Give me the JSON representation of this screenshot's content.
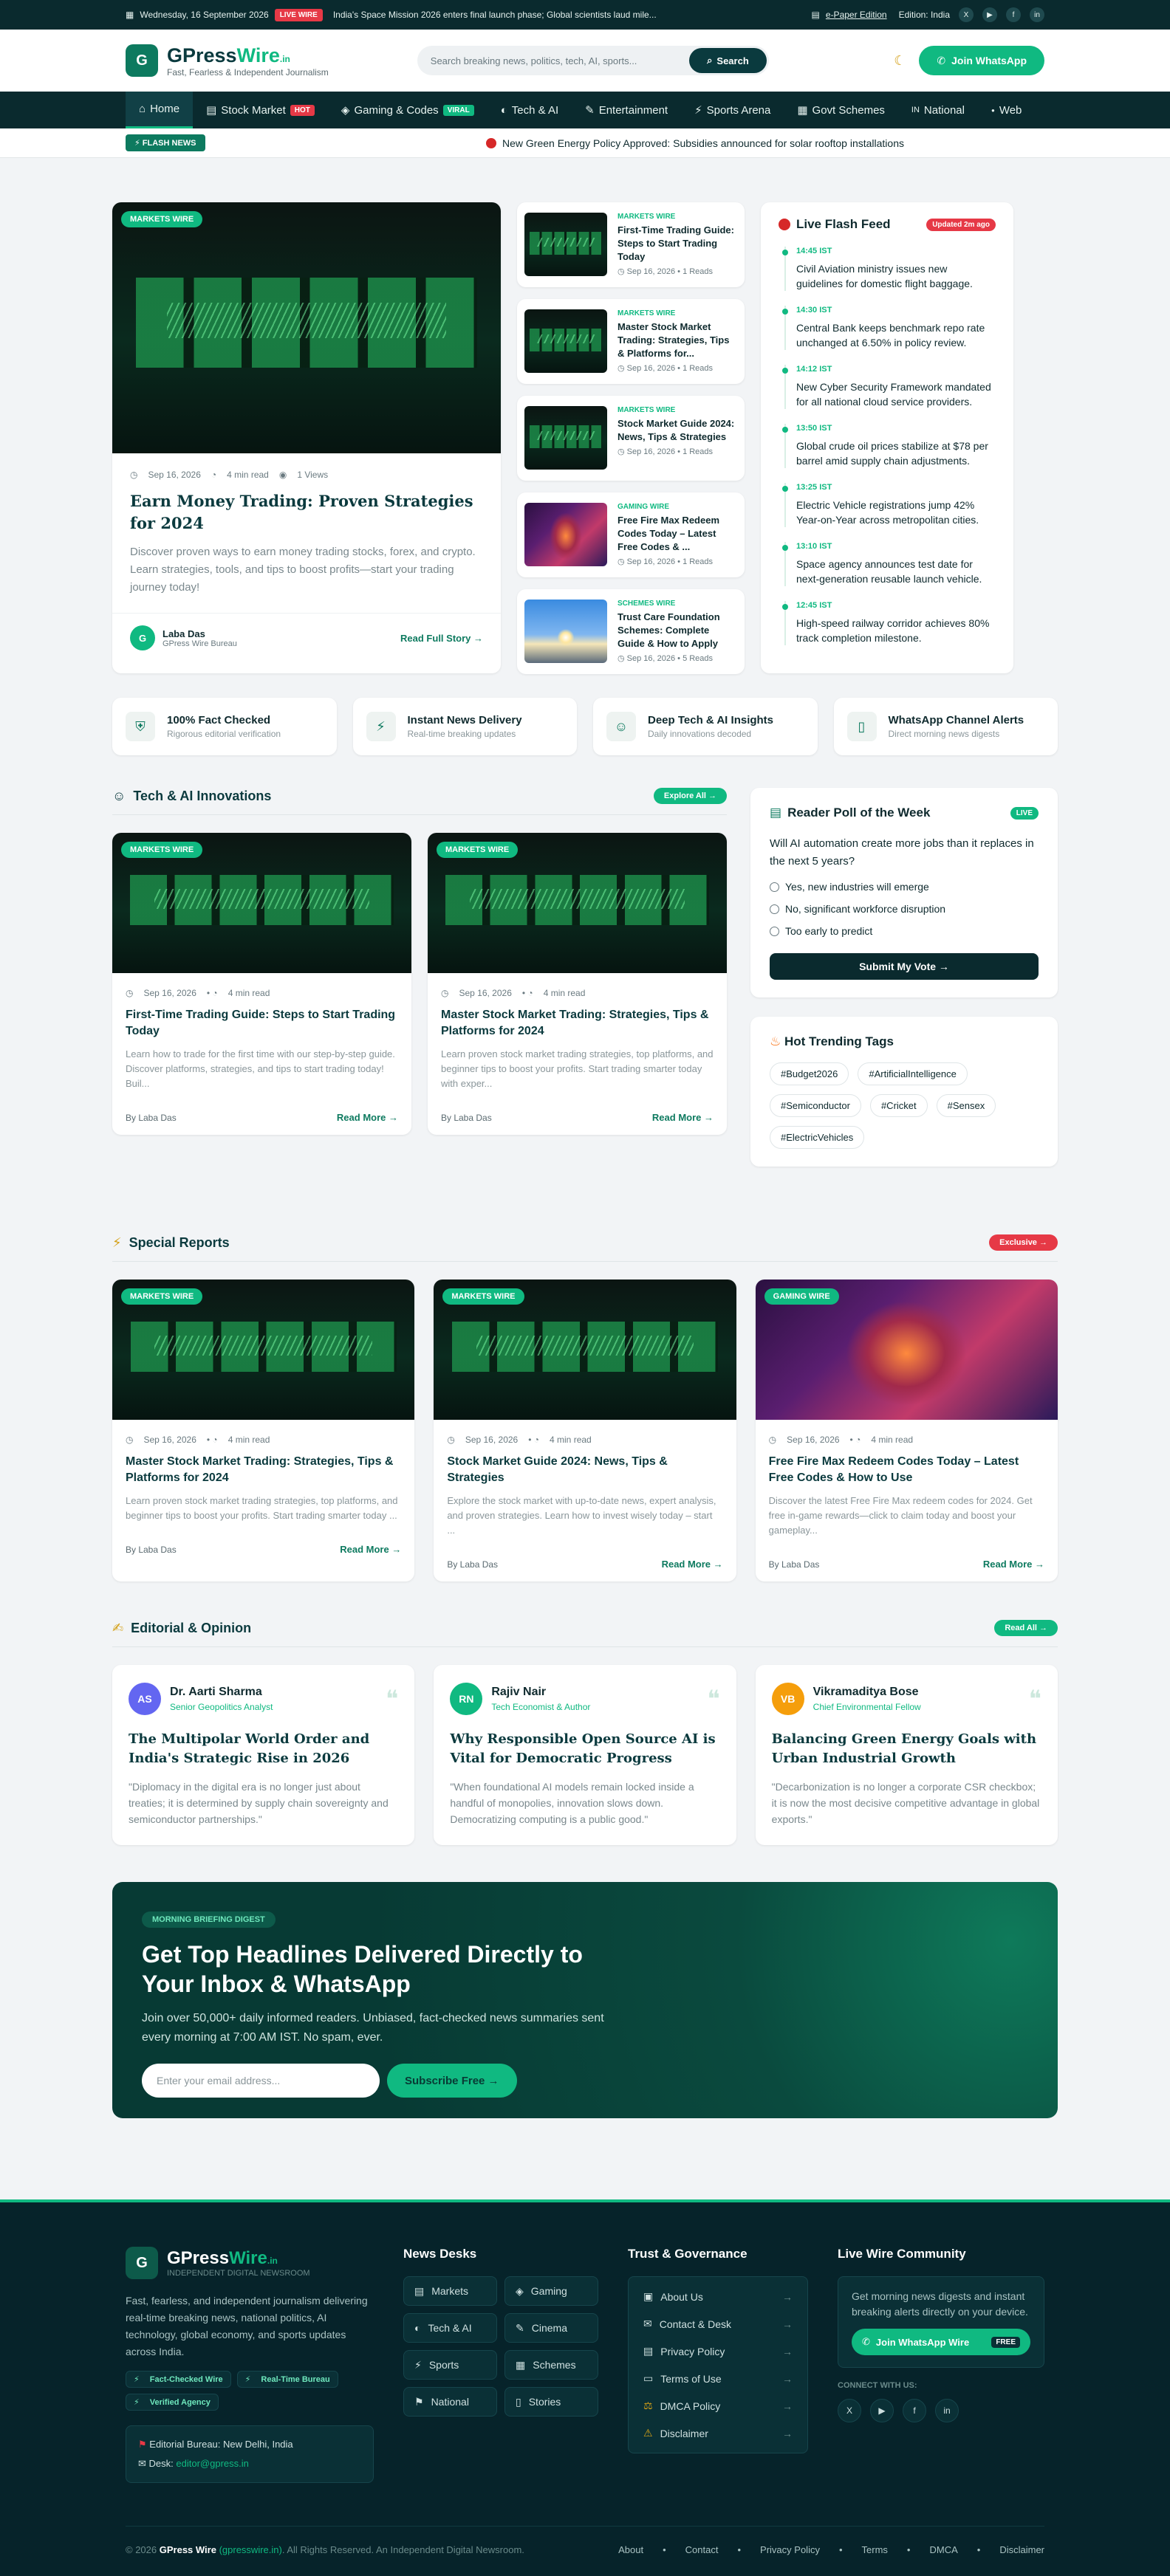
{
  "topbar": {
    "date": "Wednesday, 16 September 2026",
    "live": "LIVE WIRE",
    "ticker": "India's Space Mission 2026 enters final launch phase; Global scientists laud mile...",
    "epaper": "e-Paper Edition",
    "edition": "Edition: India",
    "social": [
      "X",
      "▶",
      "f",
      "in"
    ]
  },
  "header": {
    "logo_letter": "G",
    "name_a": "GPress",
    "name_b": "Wire",
    "tld": ".in",
    "tagline": "Fast, Fearless & Independent Journalism",
    "search_placeholder": "Search breaking news, politics, tech, AI, sports...",
    "search_btn": "Search",
    "wa_btn": "Join WhatsApp"
  },
  "nav": [
    {
      "label": "Home",
      "icon": "⌂"
    },
    {
      "label": "Stock Market",
      "icon": "▤",
      "badge": "HOT",
      "badge_color": "#e63946"
    },
    {
      "label": "Gaming & Codes",
      "icon": "◈",
      "badge": "VIRAL",
      "badge_color": "#10b981"
    },
    {
      "label": "Tech & AI",
      "icon": "◐"
    },
    {
      "label": "Entertainment",
      "icon": "✎"
    },
    {
      "label": "Sports Arena",
      "icon": "⚡"
    },
    {
      "label": "Govt Schemes",
      "icon": "▦"
    },
    {
      "label": "National",
      "icon": "IN"
    },
    {
      "label": "Web",
      "icon": "●"
    }
  ],
  "flash": {
    "label": "⚡ FLASH NEWS",
    "text": "New Green Energy Policy Approved: Subsidies announced for solar rooftop installations"
  },
  "hero": {
    "cat": "MARKETS WIRE",
    "date": "Sep 16, 2026",
    "read": "4 min read",
    "views": "1 Views",
    "title": "Earn Money Trading: Proven Strategies for 2024",
    "desc": "Discover proven ways to earn money trading stocks, forex, and crypto. Learn strategies, tools, and tips to boost profits—start your trading journey today!",
    "author": "Laba Das",
    "bureau": "GPress Wire Bureau",
    "read_full": "Read Full Story →",
    "avatar": "G"
  },
  "side": [
    {
      "cat": "MARKETS WIRE",
      "title": "First-Time Trading Guide: Steps to Start Trading Today",
      "meta": "Sep 16, 2026 • 1 Reads",
      "img": "trade"
    },
    {
      "cat": "MARKETS WIRE",
      "title": "Master Stock Market Trading: Strategies, Tips & Platforms for...",
      "meta": "Sep 16, 2026 • 1 Reads",
      "img": "trade"
    },
    {
      "cat": "MARKETS WIRE",
      "title": "Stock Market Guide 2024: News, Tips & Strategies",
      "meta": "Sep 16, 2026 • 1 Reads",
      "img": "trade"
    },
    {
      "cat": "GAMING WIRE",
      "title": "Free Fire Max Redeem Codes Today – Latest Free Codes & ...",
      "meta": "Sep 16, 2026 • 1 Reads",
      "img": "game"
    },
    {
      "cat": "SCHEMES WIRE",
      "title": "Trust Care Foundation Schemes: Complete Guide & How to Apply",
      "meta": "Sep 16, 2026 • 5 Reads",
      "img": "sky"
    }
  ],
  "feed": {
    "title": "Live Flash Feed",
    "updated": "Updated 2m ago",
    "items": [
      {
        "time": "14:45 IST",
        "text": "Civil Aviation ministry issues new guidelines for domestic flight baggage."
      },
      {
        "time": "14:30 IST",
        "text": "Central Bank keeps benchmark repo rate unchanged at 6.50% in policy review."
      },
      {
        "time": "14:12 IST",
        "text": "New Cyber Security Framework mandated for all national cloud service providers."
      },
      {
        "time": "13:50 IST",
        "text": "Global crude oil prices stabilize at $78 per barrel amid supply chain adjustments."
      },
      {
        "time": "13:25 IST",
        "text": "Electric Vehicle registrations jump 42% Year-on-Year across metropolitan cities."
      },
      {
        "time": "13:10 IST",
        "text": "Space agency announces test date for next-generation reusable launch vehicle."
      },
      {
        "time": "12:45 IST",
        "text": "High-speed railway corridor achieves 80% track completion milestone."
      }
    ]
  },
  "trust": [
    {
      "icon": "⛨",
      "title": "100% Fact Checked",
      "sub": "Rigorous editorial verification"
    },
    {
      "icon": "⚡",
      "title": "Instant News Delivery",
      "sub": "Real-time breaking updates"
    },
    {
      "icon": "☺",
      "title": "Deep Tech & AI Insights",
      "sub": "Daily innovations decoded"
    },
    {
      "icon": "▯",
      "title": "WhatsApp Channel Alerts",
      "sub": "Direct morning news digests"
    }
  ],
  "tech": {
    "title": "Tech & AI Innovations",
    "btn": "Explore All →",
    "articles": [
      {
        "cat": "MARKETS WIRE",
        "date": "Sep 16, 2026",
        "read": "4 min read",
        "title": "First-Time Trading Guide: Steps to Start Trading Today",
        "desc": "Learn how to trade for the first time with our step-by-step guide. Discover platforms, strategies, and tips to start trading today! Buil...",
        "by": "By Laba Das",
        "rm": "Read More →"
      },
      {
        "cat": "MARKETS WIRE",
        "date": "Sep 16, 2026",
        "read": "4 min read",
        "title": "Master Stock Market Trading: Strategies, Tips & Platforms for 2024",
        "desc": "Learn proven stock market trading strategies, top platforms, and beginner tips to boost your profits. Start trading smarter today with exper...",
        "by": "By Laba Das",
        "rm": "Read More →"
      }
    ]
  },
  "poll": {
    "title": "Reader Poll of the Week",
    "live": "LIVE",
    "question": "Will AI automation create more jobs than it replaces in the next 5 years?",
    "options": [
      "Yes, new industries will emerge",
      "No, significant workforce disruption",
      "Too early to predict"
    ],
    "submit": "Submit My Vote →"
  },
  "tags": {
    "title": "Hot Trending Tags",
    "items": [
      "#Budget2026",
      "#ArtificialIntelligence",
      "#Semiconductor",
      "#Cricket",
      "#Sensex",
      "#ElectricVehicles"
    ]
  },
  "special": {
    "title": "Special Reports",
    "btn": "Exclusive →",
    "articles": [
      {
        "cat": "MARKETS WIRE",
        "img": "trade",
        "date": "Sep 16, 2026",
        "read": "4 min read",
        "title": "Master Stock Market Trading: Strategies, Tips & Platforms for 2024",
        "desc": "Learn proven stock market trading strategies, top platforms, and beginner tips to boost your profits. Start trading smarter today ...",
        "by": "By Laba Das",
        "rm": "Read More →"
      },
      {
        "cat": "MARKETS WIRE",
        "img": "trade",
        "date": "Sep 16, 2026",
        "read": "4 min read",
        "title": "Stock Market Guide 2024: News, Tips & Strategies",
        "desc": "Explore the stock market with up-to-date news, expert analysis, and proven strategies. Learn how to invest wisely today – start ...",
        "by": "By Laba Das",
        "rm": "Read More →"
      },
      {
        "cat": "GAMING WIRE",
        "img": "game",
        "date": "Sep 16, 2026",
        "read": "4 min read",
        "title": "Free Fire Max Redeem Codes Today – Latest Free Codes & How to Use",
        "desc": "Discover the latest Free Fire Max redeem codes for 2024. Get free in-game rewards—click to claim today and boost your gameplay...",
        "by": "By Laba Das",
        "rm": "Read More →"
      }
    ]
  },
  "editorial": {
    "title": "Editorial & Opinion",
    "btn": "Read All →",
    "items": [
      {
        "initials": "AS",
        "color": "#6366f1",
        "name": "Dr. Aarti Sharma",
        "role": "Senior Geopolitics Analyst",
        "title": "The Multipolar World Order and India's Strategic Rise in 2026",
        "quote": "\"Diplomacy in the digital era is no longer just about treaties; it is determined by supply chain sovereignty and semiconductor partnerships.\""
      },
      {
        "initials": "RN",
        "color": "#10b981",
        "name": "Rajiv Nair",
        "role": "Tech Economist & Author",
        "title": "Why Responsible Open Source AI is Vital for Democratic Progress",
        "quote": "\"When foundational AI models remain locked inside a handful of monopolies, innovation slows down. Democratizing computing is a public good.\""
      },
      {
        "initials": "VB",
        "color": "#f59e0b",
        "name": "Vikramaditya Bose",
        "role": "Chief Environmental Fellow",
        "title": "Balancing Green Energy Goals with Urban Industrial Growth",
        "quote": "\"Decarbonization is no longer a corporate CSR checkbox; it is now the most decisive competitive advantage in global exports.\""
      }
    ]
  },
  "newsletter": {
    "kicker": "MORNING BRIEFING DIGEST",
    "title": "Get Top Headlines Delivered Directly to Your Inbox & WhatsApp",
    "desc": "Join over 50,000+ daily informed readers. Unbiased, fact-checked news summaries sent every morning at 7:00 AM IST. No spam, ever.",
    "placeholder": "Enter your email address...",
    "btn": "Subscribe Free →"
  },
  "footer": {
    "sub": "INDEPENDENT DIGITAL NEWSROOM",
    "about": "Fast, fearless, and independent journalism delivering real-time breaking news, national politics, AI technology, global economy, and sports updates across India.",
    "badges": [
      "Fact-Checked Wire",
      "Real-Time Bureau",
      "Verified Agency"
    ],
    "bureau": "Editorial Bureau: New Delhi, India",
    "desk_label": "Desk:",
    "desk": "editor@gpress.in",
    "desks_title": "News Desks",
    "desks": [
      "Markets",
      "Gaming",
      "Tech & AI",
      "Cinema",
      "Sports",
      "Schemes",
      "National",
      "Stories"
    ],
    "trust_title": "Trust & Governance",
    "trust": [
      "About Us",
      "Contact & Desk",
      "Privacy Policy",
      "Terms of Use",
      "DMCA Policy",
      "Disclaimer"
    ],
    "comm_title": "Live Wire Community",
    "comm_text": "Get morning news digests and instant breaking alerts directly on your device.",
    "comm_btn": "Join WhatsApp Wire",
    "comm_free": "FREE",
    "connect": "CONNECT WITH US:",
    "copyright_a": "© 2026",
    "copyright_b": "GPress Wire",
    "copyright_c": "(gpresswire.in)",
    "copyright_d": ". All Rights Reserved. An Independent Digital Newsroom.",
    "links": [
      "About",
      "Contact",
      "Privacy Policy",
      "Terms",
      "DMCA",
      "Disclaimer"
    ]
  }
}
